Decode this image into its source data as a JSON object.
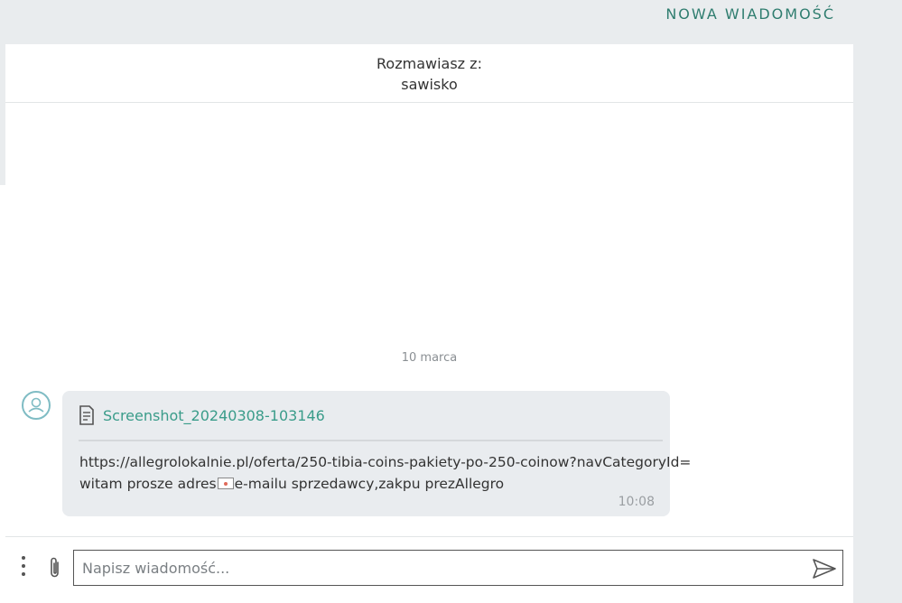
{
  "topbar": {
    "new_message_label": "NOWA WIADOMOŚĆ"
  },
  "conversation": {
    "header_label": "Rozmawiasz z:",
    "username": "sawisko",
    "date_separator": "10 marca"
  },
  "message": {
    "attachment_name": "Screenshot_20240308-103146",
    "line1": "https://allegrolokalnie.pl/oferta/250-tibia-coins-pakiety-po-250-coinow?navCategoryId=",
    "line2_before": "witam prosze adres",
    "line2_after": "e-mailu sprzedawcy,zakpu prezAllegro",
    "time": "10:08"
  },
  "composer": {
    "placeholder": "Napisz wiadomość..."
  },
  "icons": {
    "avatar": "user-avatar-icon",
    "attachment_file": "document-icon",
    "more": "kebab-menu-icon",
    "attach": "paperclip-icon",
    "send": "send-icon"
  },
  "colors": {
    "accent": "#2f7d6f",
    "link": "#3a9c8a",
    "bubble": "#e9ecef"
  }
}
